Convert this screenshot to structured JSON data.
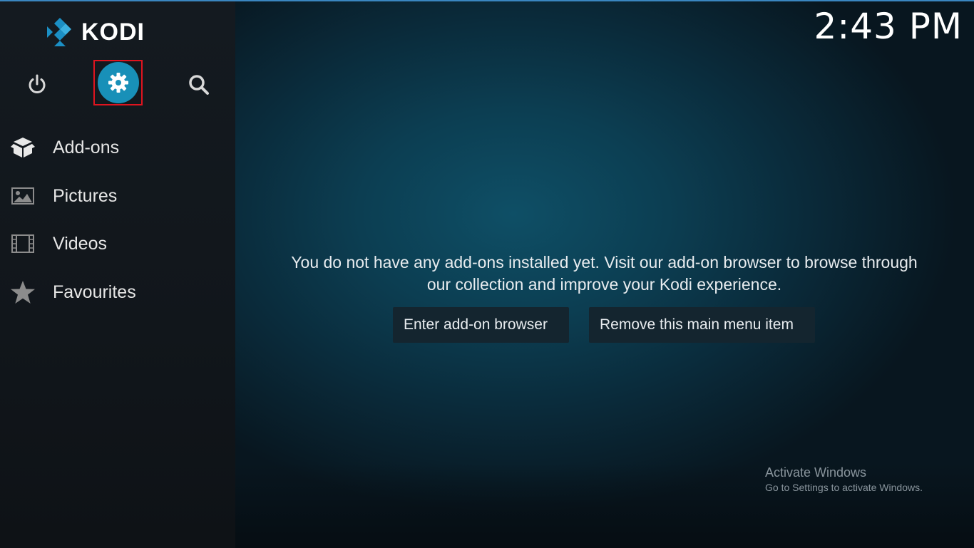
{
  "app": {
    "name": "KODI",
    "clock": "2:43 PM"
  },
  "topbar": {
    "power": {
      "icon": "power-icon"
    },
    "settings": {
      "icon": "gear-icon",
      "accent": "#1890b8",
      "highlight": "#e0141f"
    },
    "search": {
      "icon": "search-icon"
    }
  },
  "sidebar": {
    "items": [
      {
        "label": "Add-ons",
        "icon": "addons-box-icon"
      },
      {
        "label": "Pictures",
        "icon": "pictures-icon"
      },
      {
        "label": "Videos",
        "icon": "film-strip-icon"
      },
      {
        "label": "Favourites",
        "icon": "star-icon"
      }
    ]
  },
  "main": {
    "message_line1": "You do not have any add-ons installed yet. Visit our add-on browser to browse through",
    "message_line2": "our collection and improve your Kodi experience.",
    "enter_button": "Enter add-on browser",
    "remove_button": "Remove this main menu item"
  },
  "watermark": {
    "title": "Activate Windows",
    "subtitle": "Go to Settings to activate Windows."
  },
  "colors": {
    "background": "#0c3e52",
    "sidebar": "#141a20",
    "kodi_blue": "#1b8fc4"
  }
}
